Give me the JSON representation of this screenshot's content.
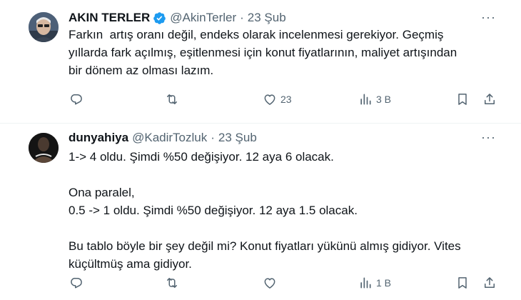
{
  "tweets": [
    {
      "name": "AKIN TERLER",
      "handle": "@AkinTerler",
      "separator": "·",
      "date": "23 Şub",
      "more_label": "···",
      "lines": [
        "Farkın  artış oranı değil, endeks olarak incelenmesi gerekiyor. Geçmiş",
        "yıllarda fark açılmış, eşitlenmesi için konut fiyatlarının, maliyet artışından",
        "bir dönem az olması lazım."
      ],
      "actions": {
        "reply": "",
        "retweet": "",
        "like": "23",
        "views": "3 B"
      }
    },
    {
      "name": "dunyahiya",
      "handle": "@KadirTozluk",
      "separator": "·",
      "date": "23 Şub",
      "more_label": "···",
      "paragraphs": [
        [
          "1-> 4 oldu. Şimdi %50 değişiyor. 12 aya 6 olacak."
        ],
        [
          "Ona paralel,",
          "0.5 -> 1 oldu. Şimdi %50 değişiyor. 12 aya 1.5 olacak."
        ],
        [
          "Bu tablo böyle bir şey değil mi? Konut fiyatları yükünü almış gidiyor. Vites",
          "küçültmüş ama gidiyor."
        ]
      ],
      "actions": {
        "reply": "",
        "retweet": "",
        "like": "",
        "views": "1 B"
      }
    }
  ],
  "colors": {
    "verified": "#1d9bf0",
    "muted": "#536471",
    "text": "#0f1419"
  }
}
